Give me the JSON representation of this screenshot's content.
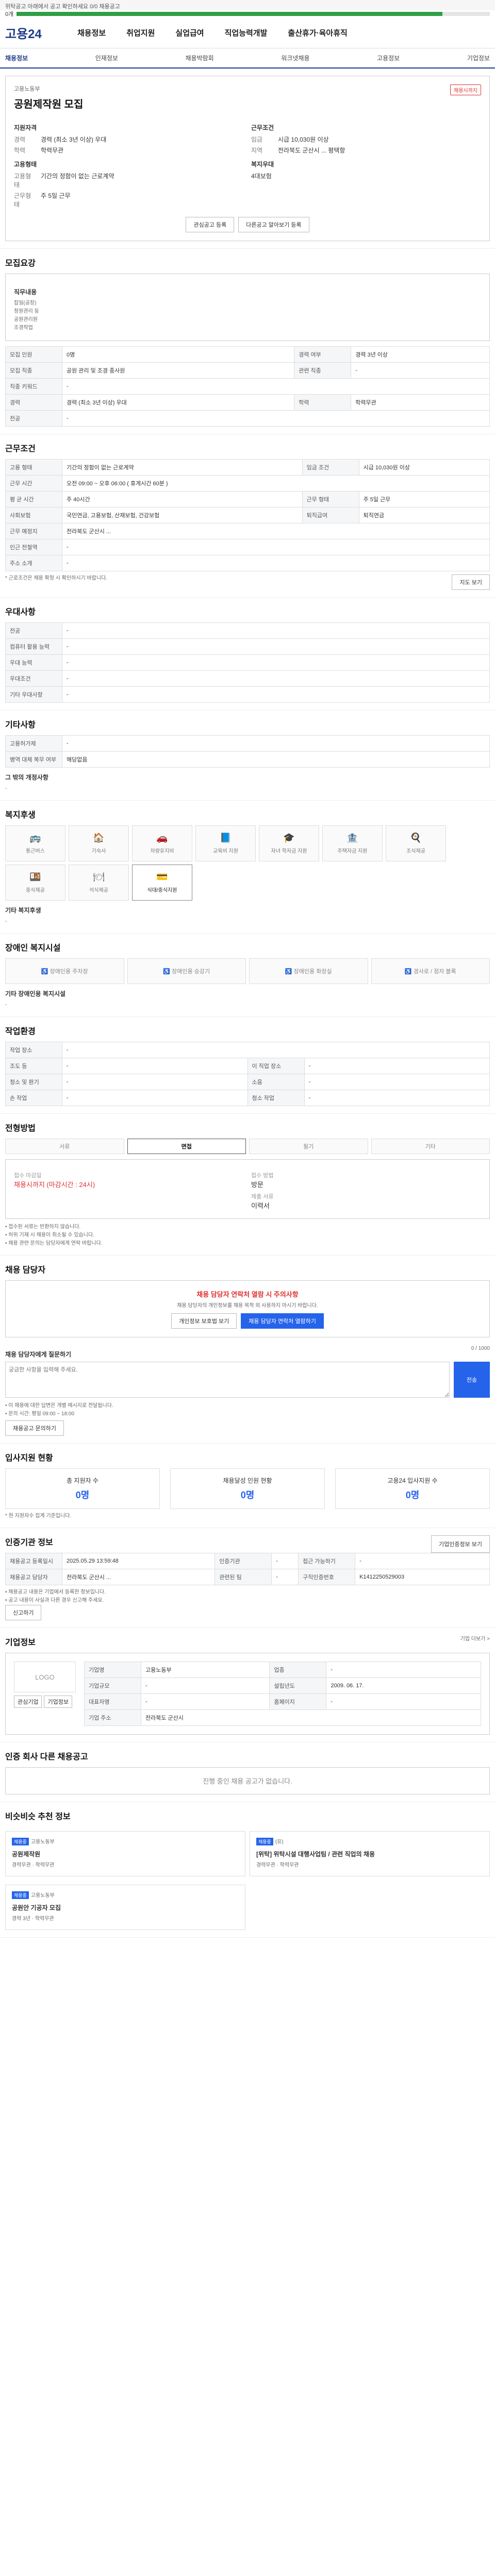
{
  "top": {
    "notice": "위탁공고 아래에서 공고 확인하세요 0/0 채용공고"
  },
  "progress": {
    "value": 0.9,
    "label": "0개"
  },
  "header": {
    "logo": "고용24",
    "menu": [
      "채용정보",
      "취업지원",
      "실업급여",
      "직업능력개발",
      "출산휴가·육아휴직"
    ]
  },
  "subnav": [
    "채용정보",
    "인재정보",
    "채용박람회",
    "워크넷채용",
    "고용정보",
    "기업정보"
  ],
  "job": {
    "company": "고용노동부",
    "title": "공원제작원 모집",
    "badge": "채용시까지",
    "left_title": "지원자격",
    "exp_label": "경력",
    "exp": "경력 (최소 3년 이상) 우대",
    "edu_label": "학력",
    "edu": "학력무관",
    "right_title": "근무조건",
    "pay_label": "임금",
    "pay": "시급 10,030원 이상",
    "loc_label": "지역",
    "loc": "전라북도 군산시 ... 평택항",
    "cond_title": "고용형태",
    "cond_label": "고용형태",
    "cond": "기간의 정함이 없는 근로계약",
    "time_label": "근무형태",
    "time": "주 5일 근무",
    "welfare_title": "복지우대",
    "welfare": "4대보험",
    "btn1": "관심공고 등록",
    "btn2": "다른공고 알아보기 등록"
  },
  "recruit": {
    "title": "모집요강",
    "sub": "직무내용",
    "desc": [
      "잡일(공장)",
      "정원관리 등",
      "공원관리원",
      "조경작업"
    ],
    "rows": [
      [
        "모집 인원",
        "0명",
        "경력 여부",
        "경력 3년 이상"
      ],
      [
        "모집 직종",
        "공원 관리 및 조경 종사원",
        "관련 직종",
        "-"
      ],
      [
        "직종 키워드",
        "-",
        "",
        ""
      ],
      [
        "경력",
        "경력 (최소 3년 이상) 우대",
        "학력",
        "학력무관"
      ],
      [
        "전공",
        "-",
        "",
        ""
      ]
    ]
  },
  "work": {
    "title": "근무조건",
    "rows": [
      [
        "고용 형태",
        "기간의 정함이 없는 근로계약",
        "임금 조건",
        "시급 10,030원 이상"
      ],
      [
        "근무 시간",
        "오전 09:00 ~ 오후 06:00 ( 휴게시간 60분 )",
        "",
        ""
      ],
      [
        "평 균 시간",
        "주 40시간",
        "근무 형태",
        "주 5일 근무"
      ],
      [
        "사회보험",
        "국민연금, 고용보험, 산재보험, 건강보험",
        "퇴직급여",
        "퇴직연금"
      ],
      [
        "근무 예정지",
        "전라북도 군산시 ...",
        "",
        ""
      ],
      [
        "인근 전철역",
        "-",
        "",
        ""
      ],
      [
        "주소 소개",
        "-",
        "",
        ""
      ]
    ],
    "map_btn": "지도 보기",
    "note": "* 근로조건은 채용 확정 시 확인하시기 바랍니다."
  },
  "pref": {
    "title": "우대사항",
    "rows": [
      [
        "전공",
        "-"
      ],
      [
        "컴퓨터 활용 능력",
        "-"
      ],
      [
        "우대 능력",
        "-"
      ],
      [
        "우대조건",
        "-"
      ],
      [
        "기타 우대사항",
        "-"
      ]
    ]
  },
  "other": {
    "title": "기타사항",
    "rows": [
      [
        "고용허가제",
        "-"
      ],
      [
        "병역 대체 복무 여부",
        "해당없음"
      ]
    ],
    "extra_label": "그 밖의 개정사항",
    "extra": "-"
  },
  "benefits": {
    "title": "복지후생",
    "items": [
      "통근버스",
      "기숙사",
      "차량유지비",
      "교육비 지원",
      "자녀 학자금 지원",
      "주택자금 지원",
      "조식제공",
      "중식제공",
      "석식제공",
      "식대/중식지원"
    ],
    "other_label": "기타 복지후생",
    "other": "-"
  },
  "disabled": {
    "title": "장애인 복지시설",
    "items": [
      "장애인용 주차장",
      "장애인용 승강기",
      "장애인용 화장실",
      "경사로 / 점자 블록"
    ],
    "other_label": "기타 장애인용 복지시설",
    "other": "-"
  },
  "env": {
    "title": "작업환경",
    "rows": [
      [
        "작업 장소",
        "-",
        "",
        ""
      ],
      [
        "조도 등",
        "-",
        "이 직업 장소",
        "-"
      ],
      [
        "청소 및 환기",
        "-",
        "소음",
        "-"
      ],
      [
        "손 작업",
        "-",
        "청소 작업",
        "-"
      ]
    ]
  },
  "process": {
    "title": "전형방법",
    "steps": [
      "서류",
      "면접",
      "필기",
      "기타"
    ],
    "active": 1,
    "deadline_label": "접수 마감일",
    "deadline": "채용시까지 (마감시간 : 24시)",
    "method_label": "접수 방법",
    "method": "방문",
    "docs_label": "제출 서류",
    "docs": "이력서",
    "notes": [
      "• 접수된 서류는 반환하지 않습니다.",
      "• 허위 기재 시 채용이 취소될 수 있습니다.",
      "• 채용 관련 문의는 담당자에게 연락 바랍니다."
    ]
  },
  "contact": {
    "title": "채용 담당자",
    "warn": "채용 담당자 연락처 열람 시 주의사항",
    "warn_desc": "채용 담당자의 개인정보를 채용 목적 외 사용하지 마시기 바랍니다.",
    "btn1": "개인정보 보호법 보기",
    "btn2": "채용 담당자 연락처 열람하기",
    "inquiry_label": "채용 담당자에게 질문하기",
    "inquiry_count": "0 / 1000",
    "inquiry_placeholder": "궁금한 사항을 입력해 주세요.",
    "inquiry_btn": "전송",
    "notes": [
      "• 이 채용에 대한 답변은 개별 메시지로 전달됩니다.",
      "• 문의 시간: 평일 09:00 ~ 18:00"
    ],
    "more_btn": "채용공고 문의하기"
  },
  "apply": {
    "title": "입사지원 현황",
    "stats": [
      [
        "총 지원자 수",
        "0명"
      ],
      [
        "채용달성 인원 현황",
        "0명"
      ],
      [
        "고용24 입사지원 수",
        "0명"
      ]
    ],
    "note": "* 현 지원자수 집계 기준입니다."
  },
  "reg": {
    "title": "인증기관 정보",
    "btn": "기업인증정보 보기",
    "rows": [
      [
        "채용공고 등록일시",
        "2025.05.29 13:59:48",
        "인증기관",
        "-",
        "접근 가능하기",
        "-"
      ],
      [
        "채용공고 담당자",
        "전라북도 군산시 ...",
        "관련된 팀",
        "-",
        "구직인증번호",
        "K1412250529003"
      ]
    ],
    "notes": [
      "• 채용공고 내용은 기업에서 등록한 정보입니다.",
      "• 공고 내용이 사실과 다른 경우 신고해 주세요."
    ],
    "report": "신고하기"
  },
  "company": {
    "title": "기업정보",
    "more": "기업 더보기 >",
    "logo": "LOGO",
    "btn1": "관심기업",
    "btn2": "기업정보",
    "rows": [
      [
        "기업명",
        "고용노동부",
        "업종",
        "-"
      ],
      [
        "기업규모",
        "-",
        "설립년도",
        "2009. 06. 17."
      ],
      [
        "대표자명",
        "-",
        "홈페이지",
        "-"
      ],
      [
        "기업 주소",
        "전라북도 군산시",
        "",
        ""
      ]
    ]
  },
  "others": {
    "title": "인증 회사 다른 채용공고",
    "empty": "진행 중인 채용 공고가 없습니다."
  },
  "similar": {
    "title": "비슷비슷 추천 정보",
    "items": [
      [
        "채용중",
        "고용노동부",
        "공원제작원",
        "경력무관 · 학력무관"
      ],
      [
        "채용중",
        "(유)",
        "[위탁] 위탁시설 대행사업팀 / 관련 직업의 채용",
        "경력무관 · 학력무관"
      ],
      [
        "채용중",
        "고용노동부",
        "공원안 기공자 모집",
        "경력 3년 · 학력무관"
      ]
    ]
  }
}
